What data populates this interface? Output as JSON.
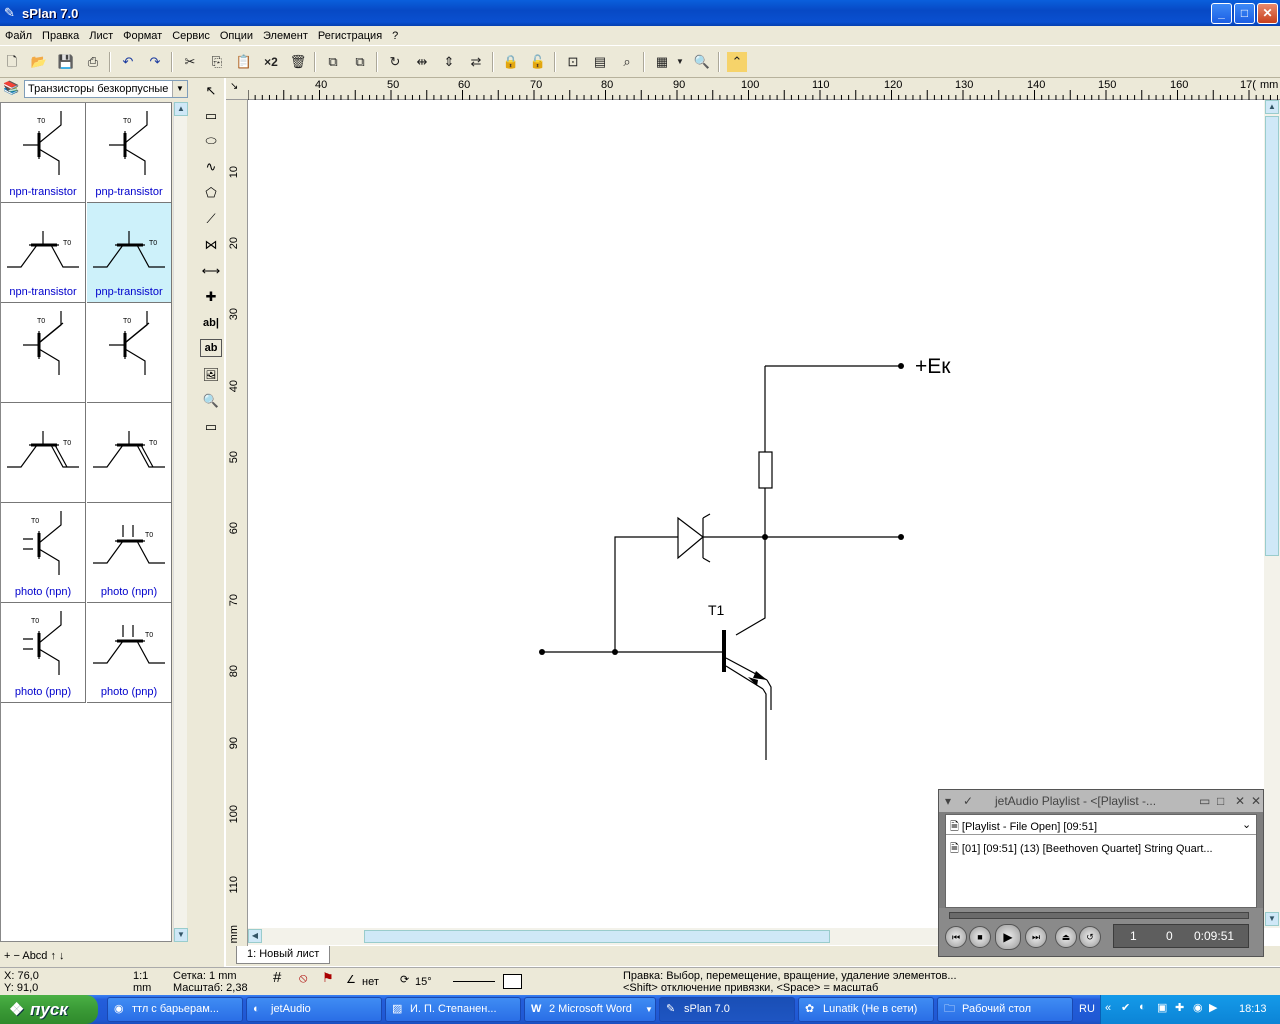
{
  "window": {
    "title": "sPlan 7.0",
    "min": "_",
    "max": "□",
    "close": "✕"
  },
  "menu": [
    "Файл",
    "Правка",
    "Лист",
    "Формат",
    "Сервис",
    "Опции",
    "Элемент",
    "Регистрация",
    "?"
  ],
  "toolbar": {
    "x2_label": "×2"
  },
  "library": {
    "selected": "Транзисторы безкорпусные",
    "items": [
      {
        "label": "npn-transistor",
        "tag": "T0"
      },
      {
        "label": "pnp-transistor",
        "tag": "T0"
      },
      {
        "label": "npn-transistor",
        "tag": "T0"
      },
      {
        "label": "pnp-transistor",
        "tag": "T0"
      },
      {
        "label": "",
        "tag": "T0"
      },
      {
        "label": "",
        "tag": "T0"
      },
      {
        "label": "",
        "tag": "T0"
      },
      {
        "label": "",
        "tag": "T0"
      },
      {
        "label": "photo (npn)",
        "tag": "T0"
      },
      {
        "label": "photo (npn)",
        "tag": "T0"
      },
      {
        "label": "photo (pnp)",
        "tag": "T0"
      },
      {
        "label": "photo (pnp)",
        "tag": "T0"
      }
    ],
    "bottom_controls": "+ − Abcd ↑ ↓"
  },
  "tools": {
    "text_tool": "ab|",
    "textbox_tool": "ab"
  },
  "ruler": {
    "h": [
      "40",
      "50",
      "60",
      "70",
      "80",
      "90",
      "100",
      "110",
      "120",
      "130",
      "140",
      "150",
      "160",
      "17("
    ],
    "h_unit": "mm",
    "v": [
      "10",
      "20",
      "30",
      "40",
      "50",
      "60",
      "70",
      "80",
      "90",
      "100",
      "110"
    ],
    "v_unit": "mm"
  },
  "schematic": {
    "supply_label": "+Eк",
    "transistor_label": "T1"
  },
  "sheet_tab": "1: Новый лист",
  "status": {
    "x": "X: 76,0",
    "y": "Y: 91,0",
    "ratio": "1:1",
    "unit": "mm",
    "grid": "Сетка: 1 mm",
    "scale": "Масштаб:  2,38",
    "snap": "нет",
    "angle": "15°",
    "hint1": "Правка: Выбор, перемещение, вращение, удаление элементов...",
    "hint2": "<Shift> отключение привязки, <Space> = масштаб"
  },
  "taskbar": {
    "start": "пуск",
    "tasks": [
      "ттл с барьерам...",
      "jetAudio",
      "И. П. Степанен...",
      "2 Microsoft Word",
      "sPlan 7.0",
      "Lunatik (Не в сети)",
      "Рабочий стол"
    ],
    "lang": "RU",
    "clock": "18:13"
  },
  "jetaudio": {
    "title": "jetAudio Playlist - <[Playlist -...",
    "rows": [
      "[Playlist - File Open]  [09:51]",
      "[01] [09:51]  (13) [Beethoven Quartet] String Quart..."
    ],
    "track": "1",
    "counter": "0",
    "time": "0:09:51"
  }
}
